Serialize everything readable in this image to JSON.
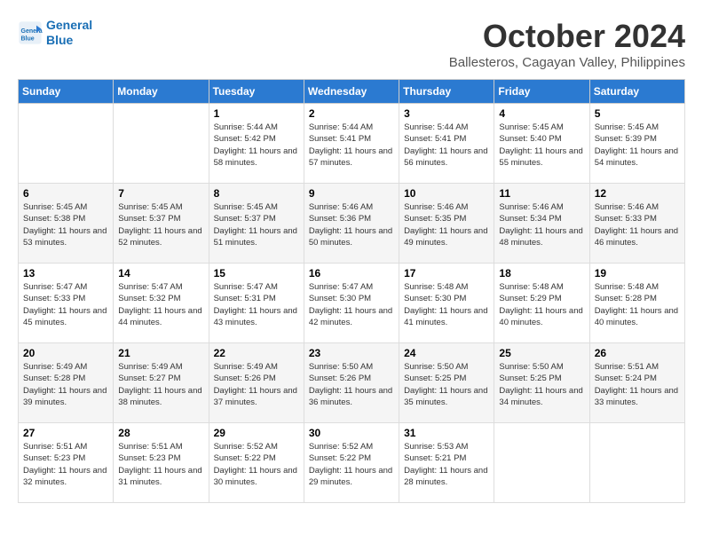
{
  "logo": {
    "line1": "General",
    "line2": "Blue"
  },
  "title": "October 2024",
  "subtitle": "Ballesteros, Cagayan Valley, Philippines",
  "headers": [
    "Sunday",
    "Monday",
    "Tuesday",
    "Wednesday",
    "Thursday",
    "Friday",
    "Saturday"
  ],
  "weeks": [
    [
      {
        "day": "",
        "info": ""
      },
      {
        "day": "",
        "info": ""
      },
      {
        "day": "1",
        "info": "Sunrise: 5:44 AM\nSunset: 5:42 PM\nDaylight: 11 hours and 58 minutes."
      },
      {
        "day": "2",
        "info": "Sunrise: 5:44 AM\nSunset: 5:41 PM\nDaylight: 11 hours and 57 minutes."
      },
      {
        "day": "3",
        "info": "Sunrise: 5:44 AM\nSunset: 5:41 PM\nDaylight: 11 hours and 56 minutes."
      },
      {
        "day": "4",
        "info": "Sunrise: 5:45 AM\nSunset: 5:40 PM\nDaylight: 11 hours and 55 minutes."
      },
      {
        "day": "5",
        "info": "Sunrise: 5:45 AM\nSunset: 5:39 PM\nDaylight: 11 hours and 54 minutes."
      }
    ],
    [
      {
        "day": "6",
        "info": "Sunrise: 5:45 AM\nSunset: 5:38 PM\nDaylight: 11 hours and 53 minutes."
      },
      {
        "day": "7",
        "info": "Sunrise: 5:45 AM\nSunset: 5:37 PM\nDaylight: 11 hours and 52 minutes."
      },
      {
        "day": "8",
        "info": "Sunrise: 5:45 AM\nSunset: 5:37 PM\nDaylight: 11 hours and 51 minutes."
      },
      {
        "day": "9",
        "info": "Sunrise: 5:46 AM\nSunset: 5:36 PM\nDaylight: 11 hours and 50 minutes."
      },
      {
        "day": "10",
        "info": "Sunrise: 5:46 AM\nSunset: 5:35 PM\nDaylight: 11 hours and 49 minutes."
      },
      {
        "day": "11",
        "info": "Sunrise: 5:46 AM\nSunset: 5:34 PM\nDaylight: 11 hours and 48 minutes."
      },
      {
        "day": "12",
        "info": "Sunrise: 5:46 AM\nSunset: 5:33 PM\nDaylight: 11 hours and 46 minutes."
      }
    ],
    [
      {
        "day": "13",
        "info": "Sunrise: 5:47 AM\nSunset: 5:33 PM\nDaylight: 11 hours and 45 minutes."
      },
      {
        "day": "14",
        "info": "Sunrise: 5:47 AM\nSunset: 5:32 PM\nDaylight: 11 hours and 44 minutes."
      },
      {
        "day": "15",
        "info": "Sunrise: 5:47 AM\nSunset: 5:31 PM\nDaylight: 11 hours and 43 minutes."
      },
      {
        "day": "16",
        "info": "Sunrise: 5:47 AM\nSunset: 5:30 PM\nDaylight: 11 hours and 42 minutes."
      },
      {
        "day": "17",
        "info": "Sunrise: 5:48 AM\nSunset: 5:30 PM\nDaylight: 11 hours and 41 minutes."
      },
      {
        "day": "18",
        "info": "Sunrise: 5:48 AM\nSunset: 5:29 PM\nDaylight: 11 hours and 40 minutes."
      },
      {
        "day": "19",
        "info": "Sunrise: 5:48 AM\nSunset: 5:28 PM\nDaylight: 11 hours and 40 minutes."
      }
    ],
    [
      {
        "day": "20",
        "info": "Sunrise: 5:49 AM\nSunset: 5:28 PM\nDaylight: 11 hours and 39 minutes."
      },
      {
        "day": "21",
        "info": "Sunrise: 5:49 AM\nSunset: 5:27 PM\nDaylight: 11 hours and 38 minutes."
      },
      {
        "day": "22",
        "info": "Sunrise: 5:49 AM\nSunset: 5:26 PM\nDaylight: 11 hours and 37 minutes."
      },
      {
        "day": "23",
        "info": "Sunrise: 5:50 AM\nSunset: 5:26 PM\nDaylight: 11 hours and 36 minutes."
      },
      {
        "day": "24",
        "info": "Sunrise: 5:50 AM\nSunset: 5:25 PM\nDaylight: 11 hours and 35 minutes."
      },
      {
        "day": "25",
        "info": "Sunrise: 5:50 AM\nSunset: 5:25 PM\nDaylight: 11 hours and 34 minutes."
      },
      {
        "day": "26",
        "info": "Sunrise: 5:51 AM\nSunset: 5:24 PM\nDaylight: 11 hours and 33 minutes."
      }
    ],
    [
      {
        "day": "27",
        "info": "Sunrise: 5:51 AM\nSunset: 5:23 PM\nDaylight: 11 hours and 32 minutes."
      },
      {
        "day": "28",
        "info": "Sunrise: 5:51 AM\nSunset: 5:23 PM\nDaylight: 11 hours and 31 minutes."
      },
      {
        "day": "29",
        "info": "Sunrise: 5:52 AM\nSunset: 5:22 PM\nDaylight: 11 hours and 30 minutes."
      },
      {
        "day": "30",
        "info": "Sunrise: 5:52 AM\nSunset: 5:22 PM\nDaylight: 11 hours and 29 minutes."
      },
      {
        "day": "31",
        "info": "Sunrise: 5:53 AM\nSunset: 5:21 PM\nDaylight: 11 hours and 28 minutes."
      },
      {
        "day": "",
        "info": ""
      },
      {
        "day": "",
        "info": ""
      }
    ]
  ]
}
